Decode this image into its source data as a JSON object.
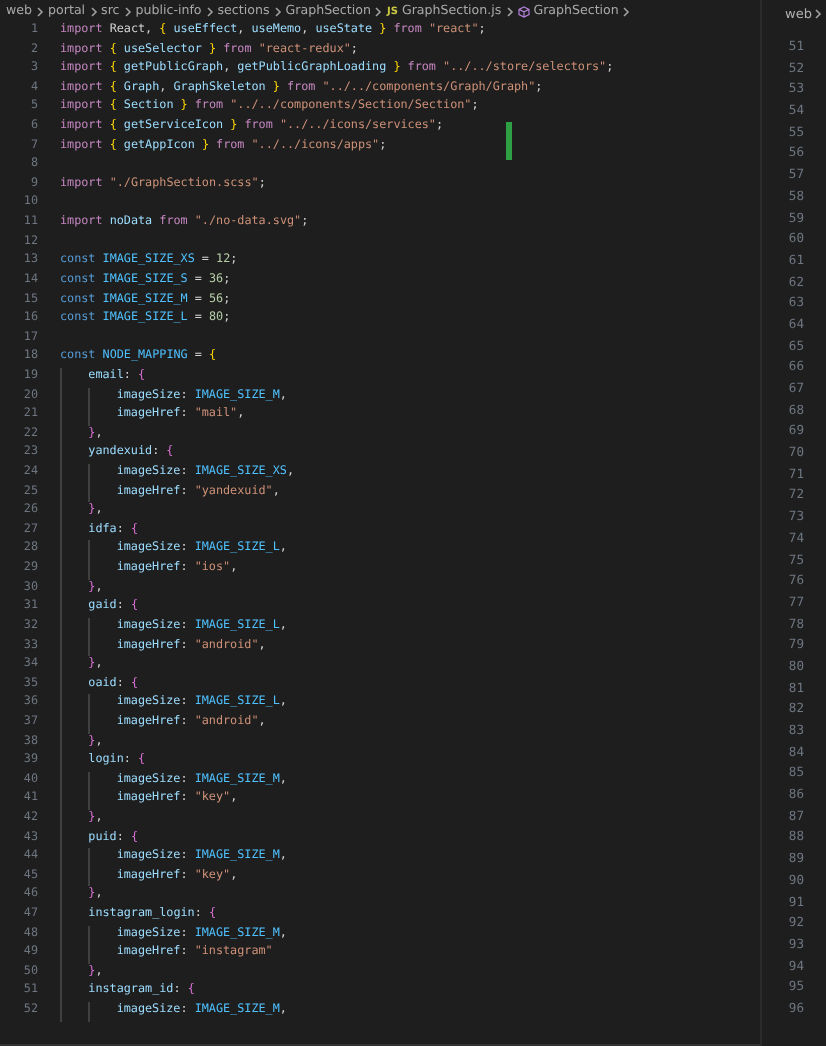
{
  "breadcrumb": [
    {
      "kind": "folder",
      "label": "web"
    },
    {
      "kind": "folder",
      "label": "portal"
    },
    {
      "kind": "folder",
      "label": "src"
    },
    {
      "kind": "folder",
      "label": "public-info"
    },
    {
      "kind": "folder",
      "label": "sections"
    },
    {
      "kind": "folder",
      "label": "GraphSection"
    },
    {
      "kind": "file",
      "badge": "JS",
      "label": "GraphSection.js"
    },
    {
      "kind": "symbol",
      "label": "GraphSection"
    }
  ],
  "editor": {
    "lines": [
      {
        "number": "1",
        "tokens": [
          {
            "kind": "kw",
            "text": "import"
          },
          {
            "kind": "p",
            "text": " React, "
          },
          {
            "kind": "b1",
            "text": "{"
          },
          {
            "kind": "var",
            "text": " useEffect"
          },
          {
            "kind": "p",
            "text": ", "
          },
          {
            "kind": "var",
            "text": "useMemo"
          },
          {
            "kind": "p",
            "text": ", "
          },
          {
            "kind": "var",
            "text": "useState "
          },
          {
            "kind": "b1",
            "text": "}"
          },
          {
            "kind": "kw",
            "text": " from "
          },
          {
            "kind": "str",
            "text": "\"react\""
          },
          {
            "kind": "p",
            "text": ";"
          }
        ]
      },
      {
        "number": "2",
        "tokens": [
          {
            "kind": "kw",
            "text": "import "
          },
          {
            "kind": "b1",
            "text": "{"
          },
          {
            "kind": "var",
            "text": " useSelector "
          },
          {
            "kind": "b1",
            "text": "}"
          },
          {
            "kind": "kw",
            "text": " from "
          },
          {
            "kind": "str",
            "text": "\"react-redux\""
          },
          {
            "kind": "p",
            "text": ";"
          }
        ]
      },
      {
        "number": "3",
        "tokens": [
          {
            "kind": "kw",
            "text": "import "
          },
          {
            "kind": "b1",
            "text": "{"
          },
          {
            "kind": "var",
            "text": " getPublicGraph"
          },
          {
            "kind": "p",
            "text": ", "
          },
          {
            "kind": "var",
            "text": "getPublicGraphLoading "
          },
          {
            "kind": "b1",
            "text": "}"
          },
          {
            "kind": "kw",
            "text": " from "
          },
          {
            "kind": "str",
            "text": "\"../../store/selectors\""
          },
          {
            "kind": "p",
            "text": ";"
          }
        ]
      },
      {
        "number": "4",
        "tokens": [
          {
            "kind": "kw",
            "text": "import "
          },
          {
            "kind": "b1",
            "text": "{"
          },
          {
            "kind": "var",
            "text": " Graph"
          },
          {
            "kind": "p",
            "text": ", "
          },
          {
            "kind": "var",
            "text": "GraphSkeleton "
          },
          {
            "kind": "b1",
            "text": "}"
          },
          {
            "kind": "kw",
            "text": " from "
          },
          {
            "kind": "str",
            "text": "\"../../components/Graph/Graph\""
          },
          {
            "kind": "p",
            "text": ";"
          }
        ]
      },
      {
        "number": "5",
        "tokens": [
          {
            "kind": "kw",
            "text": "import "
          },
          {
            "kind": "b1",
            "text": "{"
          },
          {
            "kind": "var",
            "text": " Section "
          },
          {
            "kind": "b1",
            "text": "}"
          },
          {
            "kind": "kw",
            "text": " from "
          },
          {
            "kind": "str",
            "text": "\"../../components/Section/Section\""
          },
          {
            "kind": "p",
            "text": ";"
          }
        ]
      },
      {
        "number": "6",
        "tokens": [
          {
            "kind": "kw",
            "text": "import "
          },
          {
            "kind": "b1",
            "text": "{"
          },
          {
            "kind": "var",
            "text": " getServiceIcon "
          },
          {
            "kind": "b1",
            "text": "}"
          },
          {
            "kind": "kw",
            "text": " from "
          },
          {
            "kind": "str",
            "text": "\"../../icons/services\""
          },
          {
            "kind": "p",
            "text": ";"
          }
        ]
      },
      {
        "number": "7",
        "tokens": [
          {
            "kind": "kw",
            "text": "import "
          },
          {
            "kind": "b1",
            "text": "{"
          },
          {
            "kind": "var",
            "text": " getAppIcon "
          },
          {
            "kind": "b1",
            "text": "}"
          },
          {
            "kind": "kw",
            "text": " from "
          },
          {
            "kind": "str",
            "text": "\"../../icons/apps\""
          },
          {
            "kind": "p",
            "text": ";"
          }
        ]
      },
      {
        "number": "8"
      },
      {
        "number": "9",
        "tokens": [
          {
            "kind": "kw",
            "text": "import "
          },
          {
            "kind": "str",
            "text": "\"./GraphSection.scss\""
          },
          {
            "kind": "p",
            "text": ";"
          }
        ]
      },
      {
        "number": "10"
      },
      {
        "number": "11",
        "tokens": [
          {
            "kind": "kw",
            "text": "import"
          },
          {
            "kind": "var",
            "text": " noData"
          },
          {
            "kind": "kw",
            "text": " from "
          },
          {
            "kind": "str",
            "text": "\"./no-data.svg\""
          },
          {
            "kind": "p",
            "text": ";"
          }
        ]
      },
      {
        "number": "12"
      },
      {
        "number": "13",
        "tokens": [
          {
            "kind": "decl",
            "text": "const"
          },
          {
            "kind": "cst",
            "text": " IMAGE_SIZE_XS"
          },
          {
            "kind": "p",
            "text": " = "
          },
          {
            "kind": "num",
            "text": "12"
          },
          {
            "kind": "p",
            "text": ";"
          }
        ]
      },
      {
        "number": "14",
        "tokens": [
          {
            "kind": "decl",
            "text": "const"
          },
          {
            "kind": "cst",
            "text": " IMAGE_SIZE_S"
          },
          {
            "kind": "p",
            "text": " = "
          },
          {
            "kind": "num",
            "text": "36"
          },
          {
            "kind": "p",
            "text": ";"
          }
        ]
      },
      {
        "number": "15",
        "tokens": [
          {
            "kind": "decl",
            "text": "const"
          },
          {
            "kind": "cst",
            "text": " IMAGE_SIZE_M"
          },
          {
            "kind": "p",
            "text": " = "
          },
          {
            "kind": "num",
            "text": "56"
          },
          {
            "kind": "p",
            "text": ";"
          }
        ]
      },
      {
        "number": "16",
        "tokens": [
          {
            "kind": "decl",
            "text": "const"
          },
          {
            "kind": "cst",
            "text": " IMAGE_SIZE_L"
          },
          {
            "kind": "p",
            "text": " = "
          },
          {
            "kind": "num",
            "text": "80"
          },
          {
            "kind": "p",
            "text": ";"
          }
        ]
      },
      {
        "number": "17"
      },
      {
        "number": "18",
        "tokens": [
          {
            "kind": "decl",
            "text": "const"
          },
          {
            "kind": "cst",
            "text": " NODE_MAPPING"
          },
          {
            "kind": "p",
            "text": " = "
          },
          {
            "kind": "b1",
            "text": "{"
          }
        ]
      },
      {
        "number": "19",
        "tokens": [
          {
            "kind": "var",
            "text": "    email"
          },
          {
            "kind": "p",
            "text": ": "
          },
          {
            "kind": "b2",
            "text": "{"
          }
        ]
      },
      {
        "number": "20",
        "tokens": [
          {
            "kind": "var",
            "text": "        imageSize"
          },
          {
            "kind": "p",
            "text": ": "
          },
          {
            "kind": "cst",
            "text": "IMAGE_SIZE_M"
          },
          {
            "kind": "p",
            "text": ","
          }
        ]
      },
      {
        "number": "21",
        "tokens": [
          {
            "kind": "var",
            "text": "        imageHref"
          },
          {
            "kind": "p",
            "text": ": "
          },
          {
            "kind": "str",
            "text": "\"mail\""
          },
          {
            "kind": "p",
            "text": ","
          }
        ]
      },
      {
        "number": "22",
        "tokens": [
          {
            "kind": "b2",
            "text": "    }"
          },
          {
            "kind": "p",
            "text": ","
          }
        ]
      },
      {
        "number": "23",
        "tokens": [
          {
            "kind": "var",
            "text": "    yandexuid"
          },
          {
            "kind": "p",
            "text": ": "
          },
          {
            "kind": "b2",
            "text": "{"
          }
        ]
      },
      {
        "number": "24",
        "tokens": [
          {
            "kind": "var",
            "text": "        imageSize"
          },
          {
            "kind": "p",
            "text": ": "
          },
          {
            "kind": "cst",
            "text": "IMAGE_SIZE_XS"
          },
          {
            "kind": "p",
            "text": ","
          }
        ]
      },
      {
        "number": "25",
        "tokens": [
          {
            "kind": "var",
            "text": "        imageHref"
          },
          {
            "kind": "p",
            "text": ": "
          },
          {
            "kind": "str",
            "text": "\"yandexuid\""
          },
          {
            "kind": "p",
            "text": ","
          }
        ]
      },
      {
        "number": "26",
        "tokens": [
          {
            "kind": "b2",
            "text": "    }"
          },
          {
            "kind": "p",
            "text": ","
          }
        ]
      },
      {
        "number": "27",
        "tokens": [
          {
            "kind": "var",
            "text": "    idfa"
          },
          {
            "kind": "p",
            "text": ": "
          },
          {
            "kind": "b2",
            "text": "{"
          }
        ]
      },
      {
        "number": "28",
        "tokens": [
          {
            "kind": "var",
            "text": "        imageSize"
          },
          {
            "kind": "p",
            "text": ": "
          },
          {
            "kind": "cst",
            "text": "IMAGE_SIZE_L"
          },
          {
            "kind": "p",
            "text": ","
          }
        ]
      },
      {
        "number": "29",
        "tokens": [
          {
            "kind": "var",
            "text": "        imageHref"
          },
          {
            "kind": "p",
            "text": ": "
          },
          {
            "kind": "str",
            "text": "\"ios\""
          },
          {
            "kind": "p",
            "text": ","
          }
        ]
      },
      {
        "number": "30",
        "tokens": [
          {
            "kind": "b2",
            "text": "    }"
          },
          {
            "kind": "p",
            "text": ","
          }
        ]
      },
      {
        "number": "31",
        "tokens": [
          {
            "kind": "var",
            "text": "    gaid"
          },
          {
            "kind": "p",
            "text": ": "
          },
          {
            "kind": "b2",
            "text": "{"
          }
        ]
      },
      {
        "number": "32",
        "tokens": [
          {
            "kind": "var",
            "text": "        imageSize"
          },
          {
            "kind": "p",
            "text": ": "
          },
          {
            "kind": "cst",
            "text": "IMAGE_SIZE_L"
          },
          {
            "kind": "p",
            "text": ","
          }
        ]
      },
      {
        "number": "33",
        "tokens": [
          {
            "kind": "var",
            "text": "        imageHref"
          },
          {
            "kind": "p",
            "text": ": "
          },
          {
            "kind": "str",
            "text": "\"android\""
          },
          {
            "kind": "p",
            "text": ","
          }
        ]
      },
      {
        "number": "34",
        "tokens": [
          {
            "kind": "b2",
            "text": "    }"
          },
          {
            "kind": "p",
            "text": ","
          }
        ]
      },
      {
        "number": "35",
        "tokens": [
          {
            "kind": "var",
            "text": "    oaid"
          },
          {
            "kind": "p",
            "text": ": "
          },
          {
            "kind": "b2",
            "text": "{"
          }
        ]
      },
      {
        "number": "36",
        "tokens": [
          {
            "kind": "var",
            "text": "        imageSize"
          },
          {
            "kind": "p",
            "text": ": "
          },
          {
            "kind": "cst",
            "text": "IMAGE_SIZE_L"
          },
          {
            "kind": "p",
            "text": ","
          }
        ]
      },
      {
        "number": "37",
        "tokens": [
          {
            "kind": "var",
            "text": "        imageHref"
          },
          {
            "kind": "p",
            "text": ": "
          },
          {
            "kind": "str",
            "text": "\"android\""
          },
          {
            "kind": "p",
            "text": ","
          }
        ]
      },
      {
        "number": "38",
        "tokens": [
          {
            "kind": "b2",
            "text": "    }"
          },
          {
            "kind": "p",
            "text": ","
          }
        ]
      },
      {
        "number": "39",
        "tokens": [
          {
            "kind": "var",
            "text": "    login"
          },
          {
            "kind": "p",
            "text": ": "
          },
          {
            "kind": "b2",
            "text": "{"
          }
        ]
      },
      {
        "number": "40",
        "tokens": [
          {
            "kind": "var",
            "text": "        imageSize"
          },
          {
            "kind": "p",
            "text": ": "
          },
          {
            "kind": "cst",
            "text": "IMAGE_SIZE_M"
          },
          {
            "kind": "p",
            "text": ","
          }
        ]
      },
      {
        "number": "41",
        "tokens": [
          {
            "kind": "var",
            "text": "        imageHref"
          },
          {
            "kind": "p",
            "text": ": "
          },
          {
            "kind": "str",
            "text": "\"key\""
          },
          {
            "kind": "p",
            "text": ","
          }
        ]
      },
      {
        "number": "42",
        "tokens": [
          {
            "kind": "b2",
            "text": "    }"
          },
          {
            "kind": "p",
            "text": ","
          }
        ]
      },
      {
        "number": "43",
        "tokens": [
          {
            "kind": "var",
            "text": "    puid"
          },
          {
            "kind": "p",
            "text": ": "
          },
          {
            "kind": "b2",
            "text": "{"
          }
        ]
      },
      {
        "number": "44",
        "tokens": [
          {
            "kind": "var",
            "text": "        imageSize"
          },
          {
            "kind": "p",
            "text": ": "
          },
          {
            "kind": "cst",
            "text": "IMAGE_SIZE_M"
          },
          {
            "kind": "p",
            "text": ","
          }
        ]
      },
      {
        "number": "45",
        "tokens": [
          {
            "kind": "var",
            "text": "        imageHref"
          },
          {
            "kind": "p",
            "text": ": "
          },
          {
            "kind": "str",
            "text": "\"key\""
          },
          {
            "kind": "p",
            "text": ","
          }
        ]
      },
      {
        "number": "46",
        "tokens": [
          {
            "kind": "b2",
            "text": "    }"
          },
          {
            "kind": "p",
            "text": ","
          }
        ]
      },
      {
        "number": "47",
        "tokens": [
          {
            "kind": "var",
            "text": "    instagram_login"
          },
          {
            "kind": "p",
            "text": ": "
          },
          {
            "kind": "b2",
            "text": "{"
          }
        ]
      },
      {
        "number": "48",
        "tokens": [
          {
            "kind": "var",
            "text": "        imageSize"
          },
          {
            "kind": "p",
            "text": ": "
          },
          {
            "kind": "cst",
            "text": "IMAGE_SIZE_M"
          },
          {
            "kind": "p",
            "text": ","
          }
        ]
      },
      {
        "number": "49",
        "tokens": [
          {
            "kind": "var",
            "text": "        imageHref"
          },
          {
            "kind": "p",
            "text": ": "
          },
          {
            "kind": "str",
            "text": "\"instagram\""
          }
        ]
      },
      {
        "number": "50",
        "tokens": [
          {
            "kind": "b2",
            "text": "    }"
          },
          {
            "kind": "p",
            "text": ","
          }
        ]
      },
      {
        "number": "51",
        "tokens": [
          {
            "kind": "var",
            "text": "    instagram_id"
          },
          {
            "kind": "p",
            "text": ": "
          },
          {
            "kind": "b2",
            "text": "{"
          }
        ]
      },
      {
        "number": "52",
        "tokens": [
          {
            "kind": "var",
            "text": "        imageSize"
          },
          {
            "kind": "p",
            "text": ": "
          },
          {
            "kind": "cst",
            "text": "IMAGE_SIZE_M"
          },
          {
            "kind": "p",
            "text": ","
          }
        ]
      }
    ]
  },
  "side_pane": {
    "breadcrumb": "web",
    "line_numbers": [
      "51",
      "52",
      "53",
      "54",
      "55",
      "56",
      "57",
      "58",
      "59",
      "60",
      "61",
      "62",
      "63",
      "64",
      "65",
      "66",
      "67",
      "68",
      "69",
      "70",
      "71",
      "72",
      "73",
      "74",
      "75",
      "76",
      "77",
      "78",
      "79",
      "80",
      "81",
      "82",
      "83",
      "84",
      "85",
      "86",
      "87",
      "88",
      "89",
      "90",
      "91",
      "92",
      "93",
      "94",
      "95",
      "96"
    ]
  }
}
